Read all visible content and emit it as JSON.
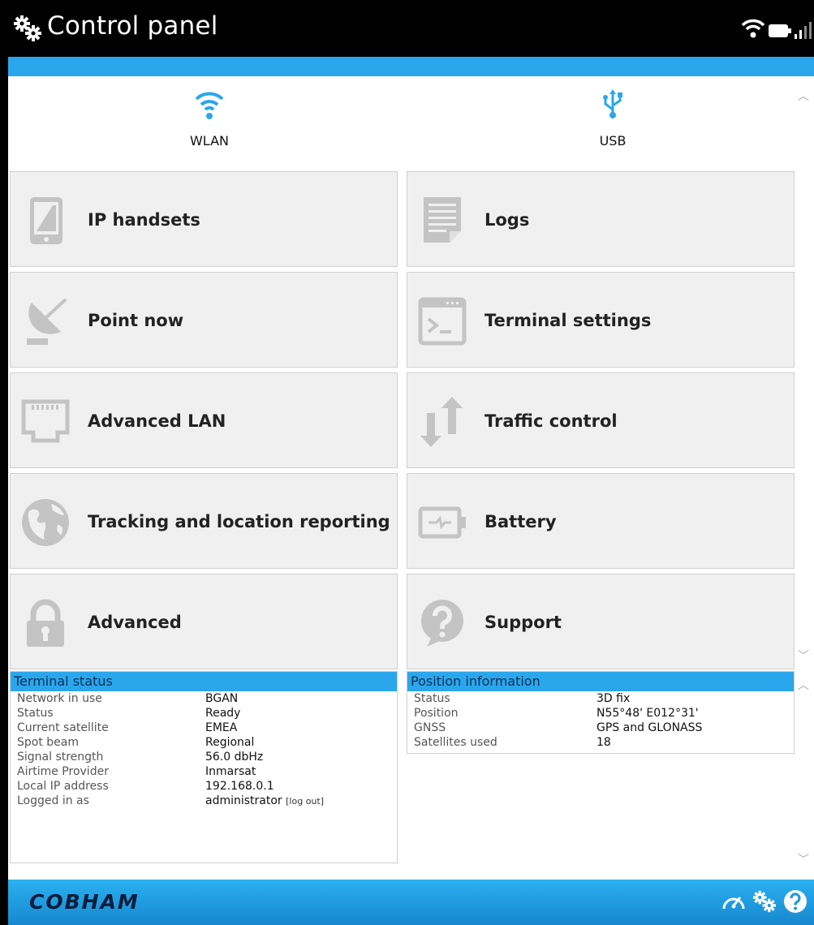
{
  "window": {
    "title": "Control panel",
    "title_icon": "gears-icon",
    "status_icons": [
      "wifi-icon",
      "battery-icon",
      "signal-bars-icon"
    ]
  },
  "top_icons": [
    {
      "label": "WLAN",
      "icon": "wifi-icon",
      "color": "#2aa7ec"
    },
    {
      "label": "USB",
      "icon": "usb-icon",
      "color": "#2aa7ec"
    }
  ],
  "tiles": {
    "left": [
      {
        "label": "IP handsets",
        "icon": "tablet-icon"
      },
      {
        "label": "Point now",
        "icon": "satellite-dish-icon"
      },
      {
        "label": "Advanced LAN",
        "icon": "ethernet-port-icon"
      },
      {
        "label": "Tracking and location reporting",
        "icon": "globe-icon"
      },
      {
        "label": "Advanced",
        "icon": "lock-icon"
      }
    ],
    "right": [
      {
        "label": "Logs",
        "icon": "document-icon"
      },
      {
        "label": "Terminal settings",
        "icon": "terminal-icon"
      },
      {
        "label": "Traffic control",
        "icon": "up-down-arrows-icon"
      },
      {
        "label": "Battery",
        "icon": "battery-icon"
      },
      {
        "label": "Support",
        "icon": "question-bubble-icon"
      }
    ]
  },
  "terminal_status": {
    "title": "Terminal status",
    "rows": [
      {
        "key": "Network in use",
        "value": "BGAN"
      },
      {
        "key": "Status",
        "value": "Ready"
      },
      {
        "key": "Current satellite",
        "value": "EMEA"
      },
      {
        "key": "Spot beam",
        "value": "Regional"
      },
      {
        "key": "Signal strength",
        "value": "56.0 dbHz"
      },
      {
        "key": "Airtime Provider",
        "value": "Inmarsat"
      },
      {
        "key": "Local IP address",
        "value": "192.168.0.1"
      },
      {
        "key": "Logged in as",
        "value": "administrator"
      }
    ],
    "logout_label": "[log out]"
  },
  "position_info": {
    "title": "Position information",
    "rows": [
      {
        "key": "Status",
        "value": "3D fix"
      },
      {
        "key": "Position",
        "value": "N55°48' E012°31'"
      },
      {
        "key": "GNSS",
        "value": "GPS and GLONASS"
      },
      {
        "key": "Satellites used",
        "value": "18"
      }
    ]
  },
  "footer": {
    "brand": "COBHAM",
    "icons": [
      "dashboard-icon",
      "gears-icon",
      "help-icon"
    ]
  },
  "colors": {
    "accent": "#2aa7ec",
    "titlebar": "#000000",
    "tile_bg": "#f0f0f0",
    "icon_gray": "#c4c4c4",
    "brand_text": "#0b1d3a"
  }
}
